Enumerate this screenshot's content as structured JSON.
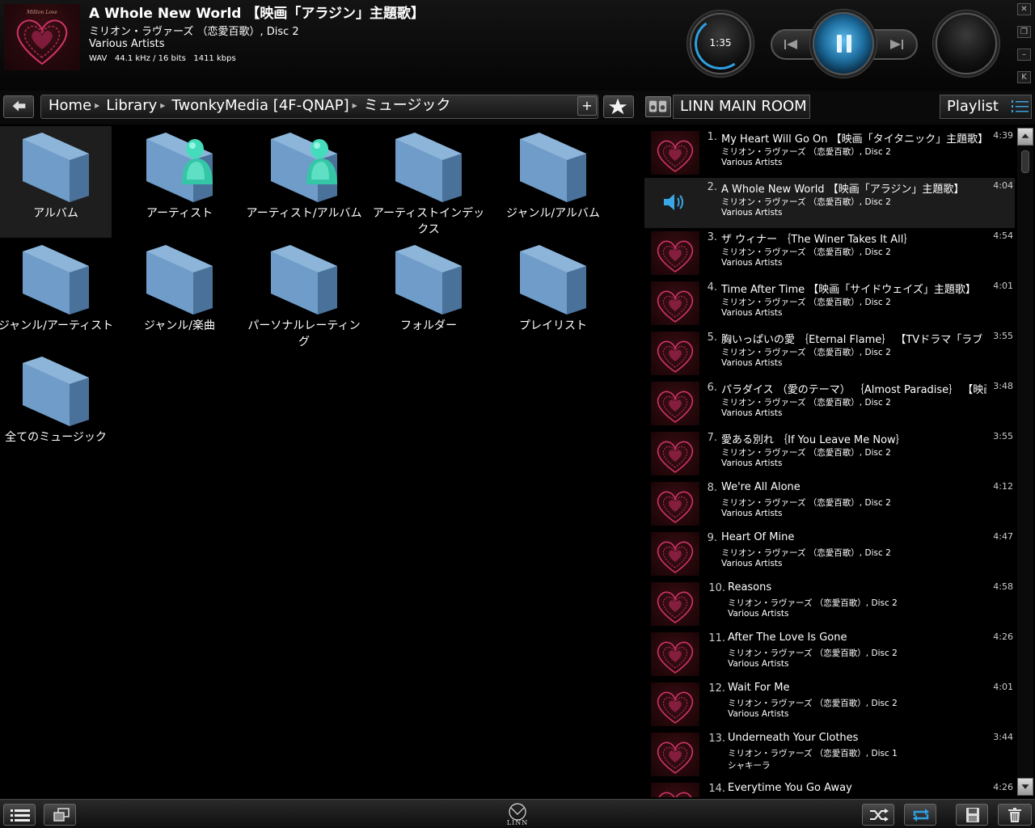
{
  "now_playing": {
    "title": "A Whole New World 【映画「アラジン」主題歌】",
    "album": "ミリオン・ラヴァーズ （恋愛百歌）, Disc 2",
    "artist": "Various Artists",
    "format": "WAV   44.1 kHz / 16 bits   1411 kbps",
    "elapsed": "1:35",
    "album_art_text": "Million Love"
  },
  "window_controls": {
    "close": "✕",
    "restore": "❐",
    "minimize": "–",
    "mini": "K"
  },
  "nav": {
    "breadcrumb": [
      "Home",
      "Library",
      "TwonkyMedia [4F-QNAP]",
      "ミュージック"
    ],
    "add_label": "+",
    "room_name": "LINN MAIN ROOM",
    "playlist_label": "Playlist"
  },
  "library": [
    {
      "label": "アルバム",
      "type": "folder",
      "selected": true
    },
    {
      "label": "アーティスト",
      "type": "folder-person"
    },
    {
      "label": "アーティスト/アルバム",
      "type": "folder-person"
    },
    {
      "label": "アーティストインデックス",
      "type": "folder"
    },
    {
      "label": "ジャンル/アルバム",
      "type": "folder"
    },
    {
      "label": "ジャンル/アーティスト",
      "type": "folder"
    },
    {
      "label": "ジャンル/楽曲",
      "type": "folder"
    },
    {
      "label": "パーソナルレーティング",
      "type": "folder"
    },
    {
      "label": "フォルダー",
      "type": "folder"
    },
    {
      "label": "プレイリスト",
      "type": "folder"
    },
    {
      "label": "全てのミュージック",
      "type": "folder"
    }
  ],
  "playlist": [
    {
      "num": "1.",
      "title": "My Heart Will Go On 【映画「タイタニック」主題歌】",
      "album": "ミリオン・ラヴァーズ （恋愛百歌）, Disc 2",
      "artist": "Various Artists",
      "duration": "4:39"
    },
    {
      "num": "2.",
      "title": "A Whole New World 【映画「アラジン」主題歌】",
      "album": "ミリオン・ラヴァーズ （恋愛百歌）, Disc 2",
      "artist": "Various Artists",
      "duration": "4:04",
      "current": true
    },
    {
      "num": "3.",
      "title": "ザ ウィナー ｛The Winer Takes It All｝",
      "album": "ミリオン・ラヴァーズ （恋愛百歌）, Disc 2",
      "artist": "Various Artists",
      "duration": "4:54"
    },
    {
      "num": "4.",
      "title": "Time After Time 【映画「サイドウェイズ」主題歌】",
      "album": "ミリオン・ラヴァーズ （恋愛百歌）, Disc 2",
      "artist": "Various Artists",
      "duration": "4:01"
    },
    {
      "num": "5.",
      "title": "胸いっぱいの愛 ｛Eternal Flame｝ 【TVドラマ「ラブ・ジェネレーション」挿入歌】",
      "album": "ミリオン・ラヴァーズ （恋愛百歌）, Disc 2",
      "artist": "Various Artists",
      "duration": "3:55"
    },
    {
      "num": "6.",
      "title": "パラダイス （愛のテーマ） ｛Almost Paradise｝ 【映画「フットルース」】",
      "album": "ミリオン・ラヴァーズ （恋愛百歌）, Disc 2",
      "artist": "Various Artists",
      "duration": "3:48"
    },
    {
      "num": "7.",
      "title": "愛ある別れ ｛If You Leave Me Now｝",
      "album": "ミリオン・ラヴァーズ （恋愛百歌）, Disc 2",
      "artist": "Various Artists",
      "duration": "3:55"
    },
    {
      "num": "8.",
      "title": "We're All Alone",
      "album": "ミリオン・ラヴァーズ （恋愛百歌）, Disc 2",
      "artist": "Various Artists",
      "duration": "4:12"
    },
    {
      "num": "9.",
      "title": "Heart Of Mine",
      "album": "ミリオン・ラヴァーズ （恋愛百歌）, Disc 2",
      "artist": "Various Artists",
      "duration": "4:47"
    },
    {
      "num": "10.",
      "title": "Reasons",
      "album": "ミリオン・ラヴァーズ （恋愛百歌）, Disc 2",
      "artist": "Various Artists",
      "duration": "4:58"
    },
    {
      "num": "11.",
      "title": "After The Love Is Gone",
      "album": "ミリオン・ラヴァーズ （恋愛百歌）, Disc 2",
      "artist": "Various Artists",
      "duration": "4:26"
    },
    {
      "num": "12.",
      "title": "Wait For Me",
      "album": "ミリオン・ラヴァーズ （恋愛百歌）, Disc 2",
      "artist": "Various Artists",
      "duration": "4:01"
    },
    {
      "num": "13.",
      "title": "Underneath Your Clothes",
      "album": "ミリオン・ラヴァーズ （恋愛百歌）, Disc 1",
      "artist": "シャキーラ",
      "duration": "3:44"
    },
    {
      "num": "14.",
      "title": "Everytime You Go Away",
      "album": "",
      "artist": "",
      "duration": "4:26"
    }
  ],
  "footer": {
    "logo_text": "LINN"
  },
  "colors": {
    "accent": "#2e9fe0",
    "folder": "#5b86b3",
    "person": "#3fd6b8",
    "heart": "#d0346a"
  }
}
